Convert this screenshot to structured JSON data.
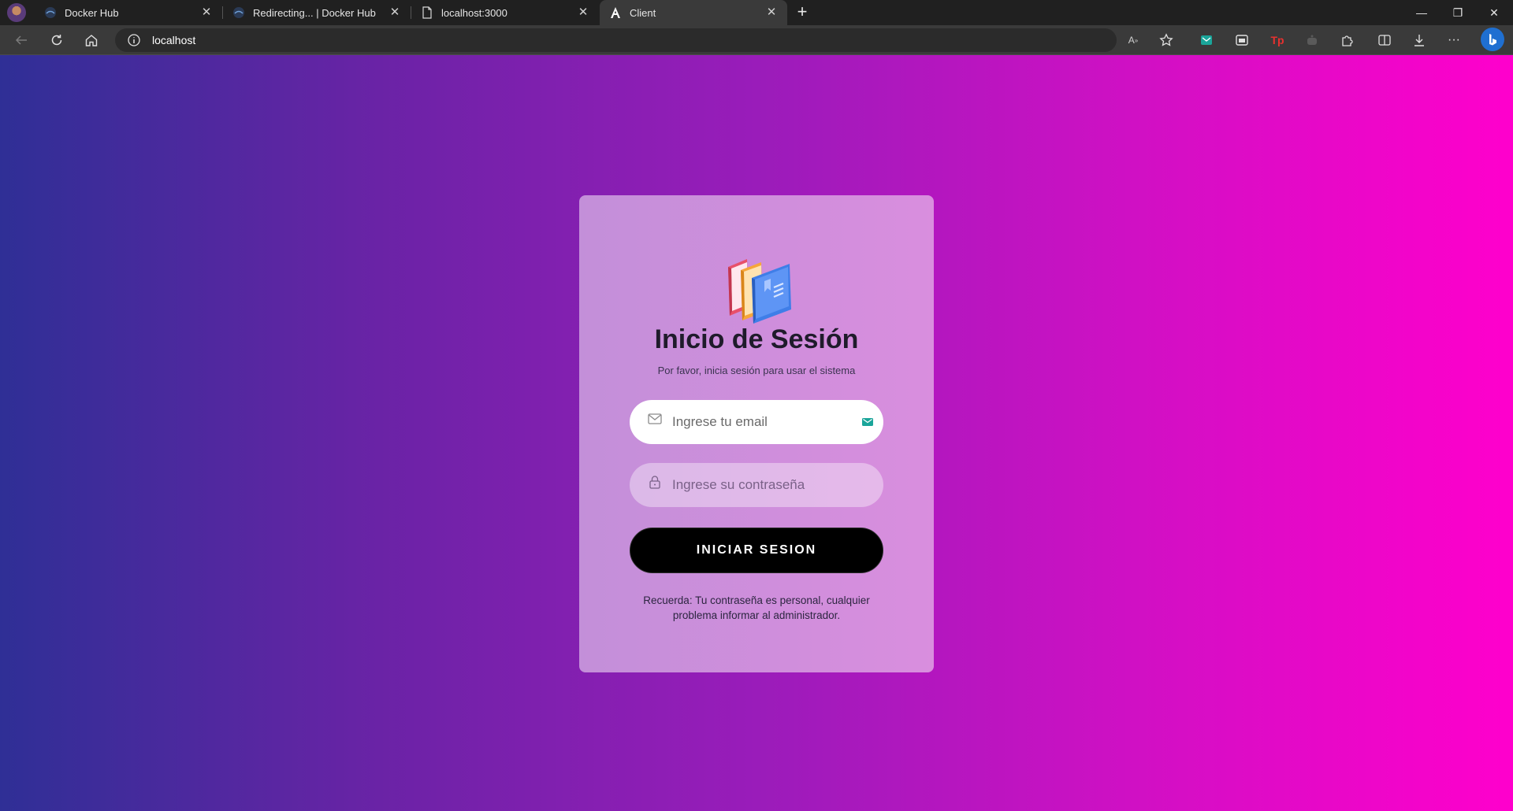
{
  "browser": {
    "tabs": [
      {
        "label": "Docker Hub",
        "close": "✕"
      },
      {
        "label": "Redirecting... | Docker Hub",
        "close": "✕"
      },
      {
        "label": "localhost:3000",
        "close": "✕"
      },
      {
        "label": "Client",
        "close": "✕"
      }
    ],
    "active_tab": "Client",
    "new_tab": "+",
    "window_controls": {
      "minimize": "—",
      "restore": "❐",
      "close": "✕"
    },
    "address": "localhost",
    "menu": "···"
  },
  "login": {
    "title": "Inicio de Sesión",
    "subtitle": "Por favor, inicia sesión para usar el sistema",
    "email_placeholder": "Ingrese tu email",
    "password_placeholder": "Ingrese su contraseña",
    "submit_label": "INICIAR SESION",
    "note": "Recuerda: Tu contraseña es personal, cualquier problema informar al administrador."
  },
  "colors": {
    "gradient_start": "#2f2f96",
    "gradient_end": "#ff00cc",
    "card": "#cf8edc",
    "button": "#000000"
  }
}
